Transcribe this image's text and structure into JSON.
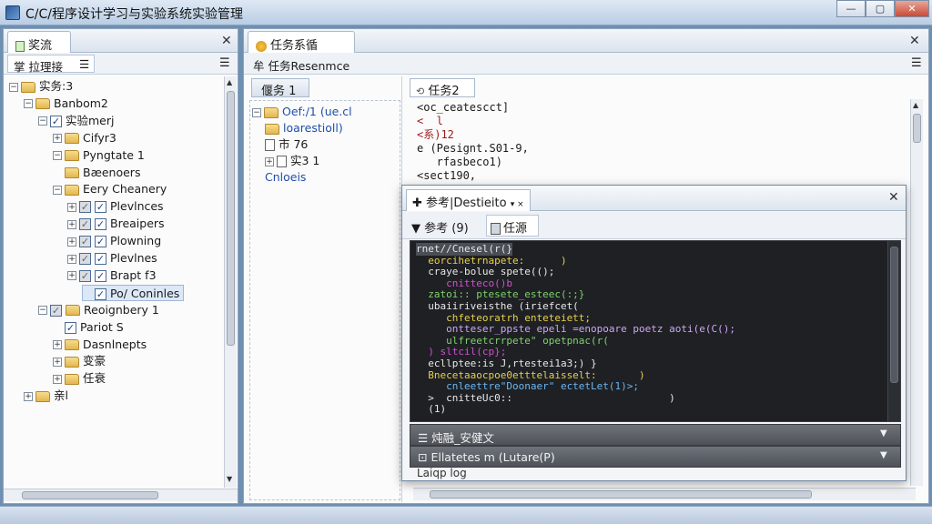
{
  "window": {
    "title": "C/C/程序设计学习与实验系统实验管理",
    "minimize": "—",
    "maximize": "▢",
    "close": "✕"
  },
  "left_panel": {
    "tab_label": "奖流",
    "close": "✕",
    "toolbar_label": "掌 拉理接",
    "toolbar_icon": "☰",
    "tree": [
      {
        "label": "实务:3",
        "level": 0,
        "expander": "−",
        "icon": "folder",
        "check": ""
      },
      {
        "label": "Banbom2",
        "level": 1,
        "expander": "−",
        "icon": "folder",
        "check": ""
      },
      {
        "label": "实验merj",
        "level": 2,
        "expander": "−",
        "icon": "check",
        "check": "✓"
      },
      {
        "label": "Cifyr3",
        "level": 3,
        "expander": "+",
        "icon": "folder",
        "check": ""
      },
      {
        "label": "Pyngtate 1",
        "level": 3,
        "expander": "−",
        "icon": "folder",
        "check": ""
      },
      {
        "label": "Bæenoers",
        "level": 3,
        "expander": "",
        "icon": "folder",
        "check": ""
      },
      {
        "label": "Eery Cheanery",
        "level": 3,
        "expander": "−",
        "icon": "folder",
        "check": ""
      },
      {
        "label": "Plevlnces",
        "level": 4,
        "expander": "+",
        "icon": "check",
        "check": "✓"
      },
      {
        "label": "Breaipers",
        "level": 4,
        "expander": "+",
        "icon": "check",
        "check": "✓"
      },
      {
        "label": "Plowning",
        "level": 4,
        "expander": "+",
        "icon": "check",
        "check": "✓"
      },
      {
        "label": "Plevlnes",
        "level": 4,
        "expander": "+",
        "icon": "check",
        "check": "✓"
      },
      {
        "label": "Brapt f3",
        "level": 4,
        "expander": "+",
        "icon": "check",
        "check": "✓"
      },
      {
        "label": "Po/ Coninles",
        "level": 5,
        "expander": "",
        "icon": "check",
        "check": "✓"
      },
      {
        "label": "Reoignbery 1",
        "level": 2,
        "expander": "−",
        "icon": "folder",
        "check": "✓"
      },
      {
        "label": "Pariot S",
        "level": 3,
        "expander": "",
        "icon": "check",
        "check": "✓"
      },
      {
        "label": "Dasnlnepts",
        "level": 3,
        "expander": "+",
        "icon": "folder",
        "check": ""
      },
      {
        "label": "变豪",
        "level": 3,
        "expander": "+",
        "icon": "folder",
        "check": ""
      },
      {
        "label": "任衰",
        "level": 3,
        "expander": "+",
        "icon": "folder",
        "check": ""
      },
      {
        "label": "亲l",
        "level": 1,
        "expander": "+",
        "icon": "folder",
        "check": ""
      }
    ]
  },
  "main_panel": {
    "tab_label": "任务系循",
    "close": "✕",
    "toolbar_label": "牟 任务Resenmce",
    "toolbar_icon": "☰",
    "subtab1": "偃务 1",
    "subtab2": "任务2",
    "subtree": [
      {
        "label": "Oef:/1 (ue.cl",
        "kind": "folder",
        "expander": "−"
      },
      {
        "label": "loarestioll)",
        "kind": "folder",
        "expander": ""
      },
      {
        "label": "市 76",
        "kind": "doc",
        "expander": ""
      },
      {
        "label": "实3 1",
        "kind": "doc",
        "expander": "+"
      },
      {
        "label": "Cnloeis",
        "kind": "text",
        "expander": ""
      }
    ],
    "code_lines": [
      {
        "text": "<oc_ceatescct]",
        "color": "#1a1a1a"
      },
      {
        "text": "<  l",
        "color": "#9a1b1b"
      },
      {
        "text": "<系)12",
        "color": "#9a1b1b"
      },
      {
        "text": "e (Pesignt.S01-9,",
        "color": "#1a1a1a"
      },
      {
        "text": "   rfasbeco1)",
        "color": "#1a1a1a"
      },
      {
        "text": "<sect190,",
        "color": "#1a1a1a"
      }
    ]
  },
  "popup": {
    "tab_label": "参考|Destieito",
    "close": "✕",
    "toolbar_left": "▼ 参考 (9)",
    "toolbar_right": "任源",
    "editor_lines": [
      {
        "text": "rnet//Cnesel(r(}",
        "color": "#e8e8e8",
        "sel": true
      },
      {
        "text": "  eorcihetrnapete:      )",
        "color": "#e8d04a"
      },
      {
        "text": "  craye-bolue spete(();",
        "color": "#e8e8e8"
      },
      {
        "text": "     cnitteco()b",
        "color": "#d34fd1"
      },
      {
        "text": "  zatoi:: ptesete_esteec(:;}",
        "color": "#7fd26b"
      },
      {
        "text": "  ubaiiriveisthe (iriefcet(",
        "color": "#e8e8e8"
      },
      {
        "text": "     chfeteoratrh enteteiett;",
        "color": "#e8d04a"
      },
      {
        "text": "     ontteser_ppste epeli =enopoare poetz aoti(e(C();",
        "color": "#cfa7f0"
      },
      {
        "text": "     ulfreetcrrpete\" opetpnac(r(",
        "color": "#7fd26b"
      },
      {
        "text": "  ) sltcil(cp};",
        "color": "#d34fd1"
      },
      {
        "text": "  ecllptee:is J,rtestei1a3;) }",
        "color": "#e8e8e8"
      },
      {
        "text": "  Bnecetaaocpoe0etttelaisselt:       )",
        "color": "#e8d04a"
      },
      {
        "text": "     cnleettre\"Doonaer\" ectetLet(1)>;",
        "color": "#6bb6f0"
      },
      {
        "text": "  >  cnitteUc0::                          )",
        "color": "#e8e8e8"
      },
      {
        "text": "  (1)",
        "color": "#e8e8e8"
      }
    ],
    "bar1": "☰ 炖融_安健文",
    "bar2": "⊡ Ellatetes m (Lutare(P)",
    "bar_arrow": "▼",
    "footer": "Laiqp log"
  }
}
